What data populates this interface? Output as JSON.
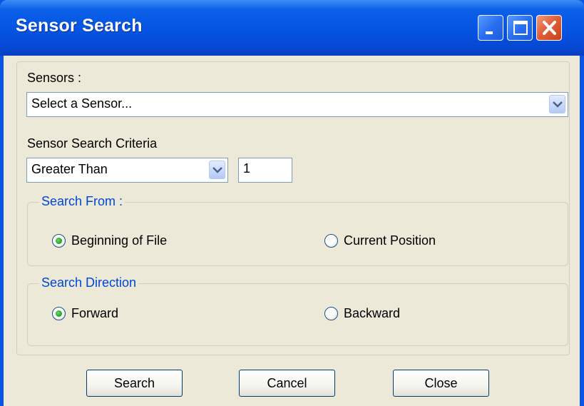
{
  "window": {
    "title": "Sensor Search"
  },
  "sensors": {
    "label": "Sensors :",
    "selected": "Select a Sensor..."
  },
  "criteria": {
    "label": "Sensor Search Criteria",
    "operator": "Greater Than",
    "value": "1"
  },
  "search_from": {
    "legend": "Search From :",
    "options": [
      {
        "label": "Beginning of File",
        "checked": true
      },
      {
        "label": "Current Position",
        "checked": false
      }
    ]
  },
  "search_direction": {
    "legend": "Search Direction",
    "options": [
      {
        "label": "Forward",
        "checked": true
      },
      {
        "label": "Backward",
        "checked": false
      }
    ]
  },
  "buttons": {
    "search": "Search",
    "cancel": "Cancel",
    "close": "Close"
  },
  "colors": {
    "titlebar": "#0554e2",
    "client_bg": "#ece9d8",
    "group_legend": "#0046d5",
    "close_button": "#e0603a",
    "radio_checked": "#28a428"
  },
  "icons": {
    "minimize": "minimize-icon",
    "maximize": "maximize-icon",
    "close": "close-icon",
    "dropdown": "chevron-down-icon"
  }
}
